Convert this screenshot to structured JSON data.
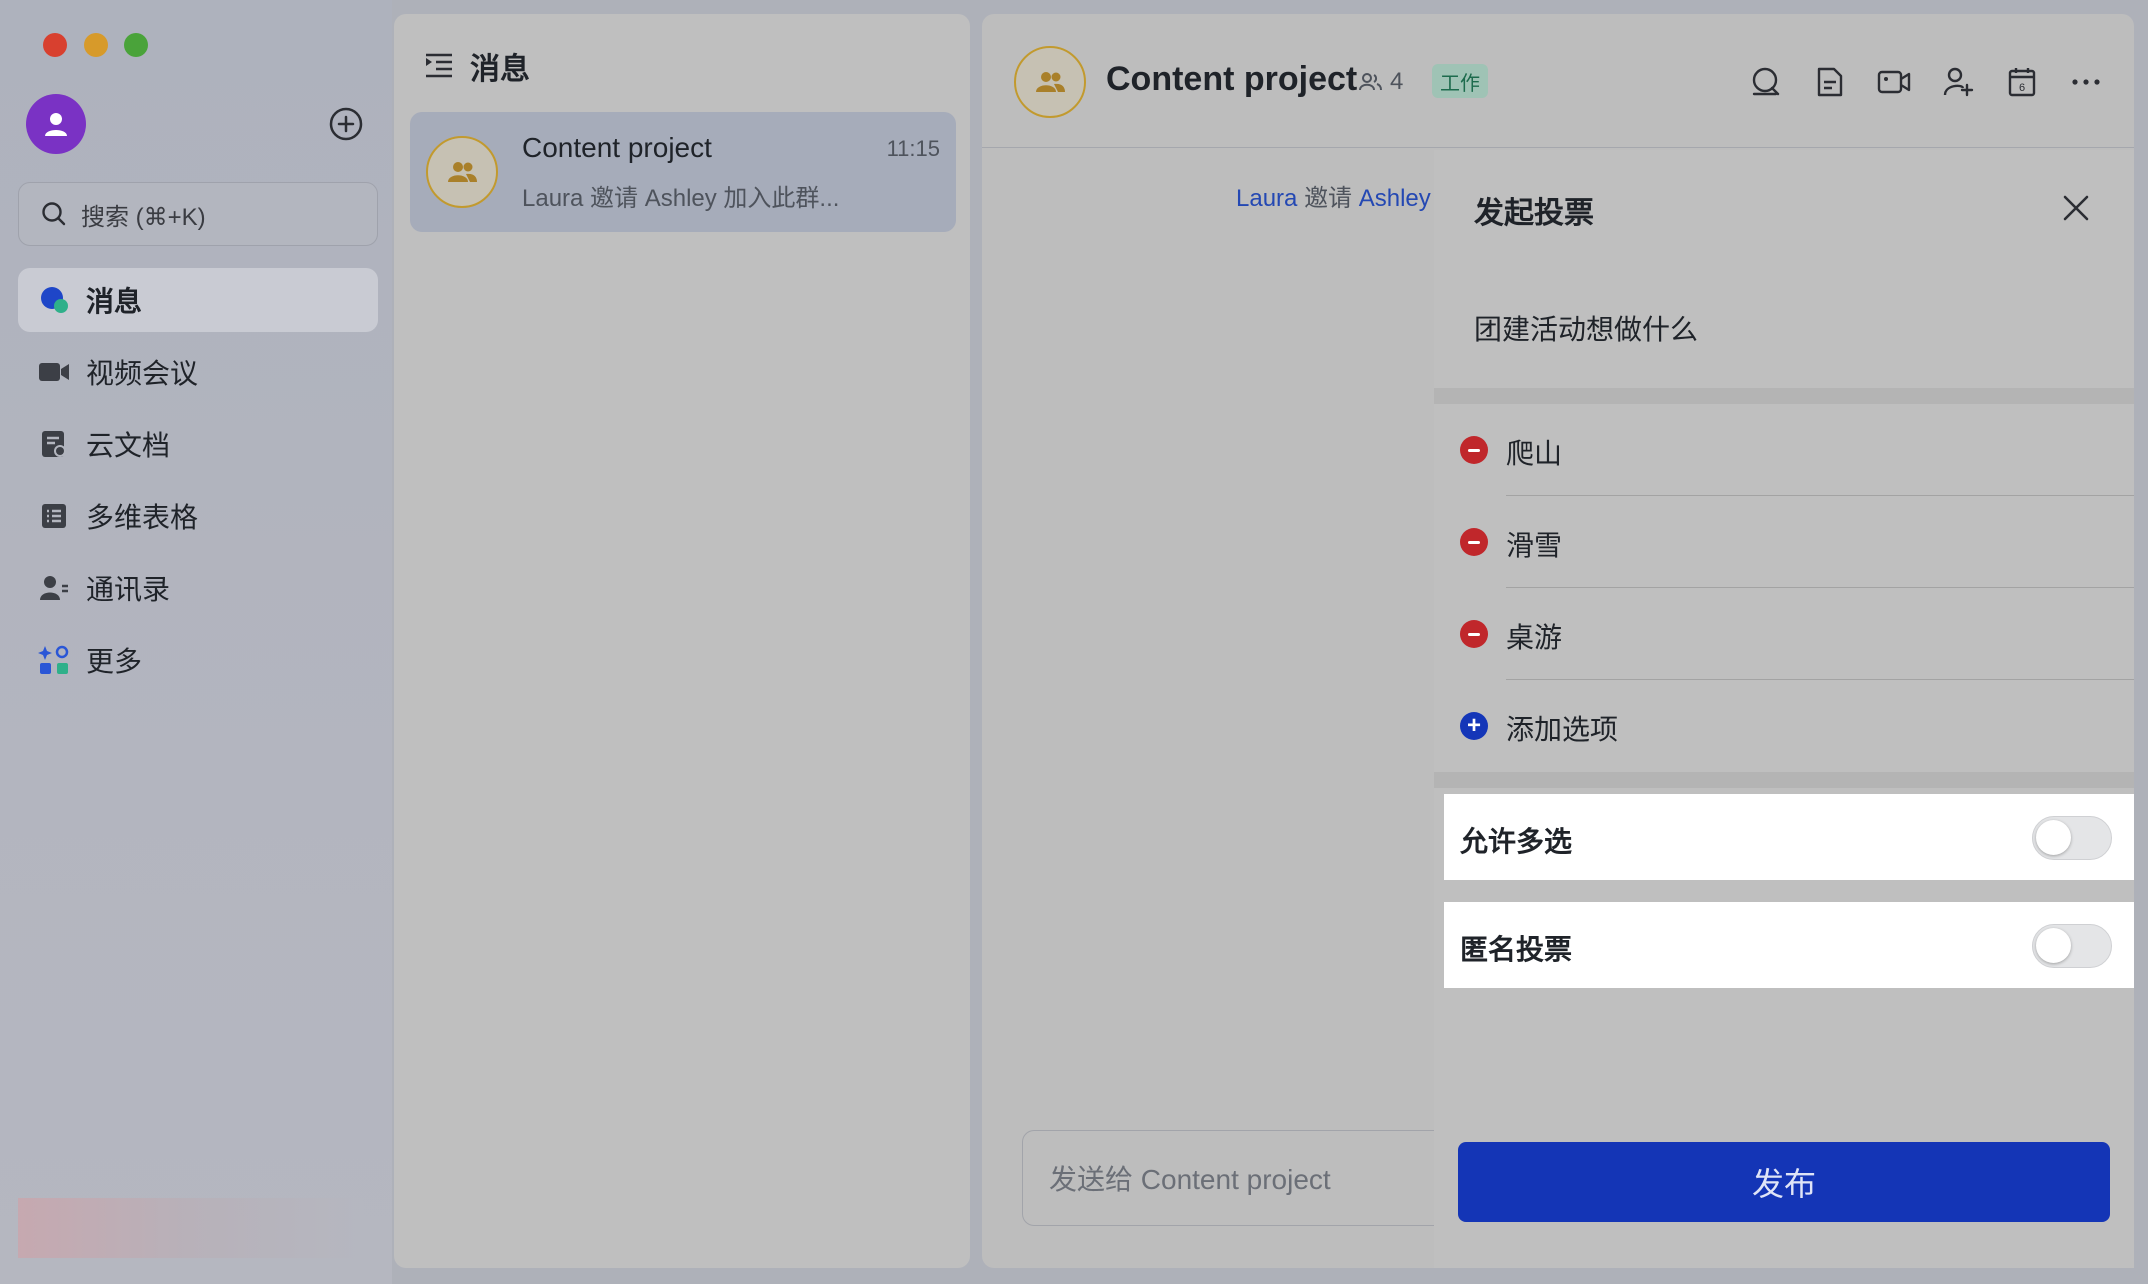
{
  "sidebar": {
    "search_placeholder": "搜索 (⌘+K)",
    "items": [
      {
        "label": "消息",
        "icon": "chat-bubble-icon",
        "active": true
      },
      {
        "label": "视频会议",
        "icon": "video-camera-icon"
      },
      {
        "label": "云文档",
        "icon": "cloud-doc-icon"
      },
      {
        "label": "多维表格",
        "icon": "table-icon"
      },
      {
        "label": "通讯录",
        "icon": "contacts-icon"
      },
      {
        "label": "更多",
        "icon": "more-apps-icon"
      }
    ]
  },
  "chat_list": {
    "title": "消息",
    "items": [
      {
        "name": "Content project",
        "time": "11:15",
        "preview": "Laura 邀请 Ashley 加入此群..."
      }
    ]
  },
  "conversation": {
    "title": "Content project",
    "member_count": "4",
    "tag": "工作",
    "system_message": {
      "actor": "Laura",
      "verb": "邀请",
      "target": "Ashley"
    },
    "composer_placeholder": "发送给 Content project",
    "toolbar_icons": [
      "search-icon",
      "document-icon",
      "video-call-icon",
      "add-member-icon",
      "calendar-icon",
      "more-icon"
    ],
    "calendar_day": "6"
  },
  "poll": {
    "title": "发起投票",
    "question": "团建活动想做什么",
    "options": [
      "爬山",
      "滑雪",
      "桌游"
    ],
    "add_option": "添加选项",
    "settings": [
      {
        "label": "允许多选",
        "enabled": false
      },
      {
        "label": "匿名投票",
        "enabled": false
      }
    ],
    "publish_label": "发布"
  },
  "colors": {
    "primary": "#1435b6",
    "danger": "#c0272b",
    "avatar_purple": "#7a32c4",
    "group_avatar_ring": "#c29a2e"
  }
}
